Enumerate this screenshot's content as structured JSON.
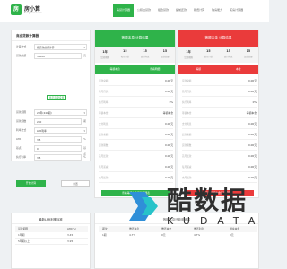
{
  "header": {
    "logo_glyph": "房",
    "brand_title": "房小算",
    "brand_sub": "fangxiaosuan",
    "nav": [
      "房贷计算器",
      "公积金贷款",
      "组合贷款",
      "提前还款",
      "税费计算",
      "购房能力",
      "买房计算器"
    ]
  },
  "form": {
    "title": "商业贷款计算器",
    "rows": [
      {
        "label": "计算方式",
        "value": "按贷款总额计算",
        "unit": ""
      },
      {
        "label": "贷款总额",
        "value": "50000",
        "unit": "元"
      },
      {
        "label": "贷款期限",
        "value": "20年(240期)",
        "unit": ""
      },
      {
        "label": "贷款期数",
        "value": "240",
        "unit": "期"
      },
      {
        "label": "利率方式",
        "value": "LPR利率",
        "unit": ""
      },
      {
        "label": "LPR",
        "value": "3.5",
        "unit": "%"
      },
      {
        "label": "基点",
        "value": "0",
        "unit": "基点"
      },
      {
        "label": "执行利率",
        "value": "3.5",
        "unit": "%"
      }
    ],
    "advanced_label": "显示高级设置",
    "calc_label": "开始计算",
    "reset_label": "重置"
  },
  "panels": [
    {
      "title": "等额本息 计算结果",
      "stats": [
        {
          "value": "1年",
          "key": "贷款期限"
        },
        {
          "value": "15",
          "key": "每月月供"
        },
        {
          "value": "15",
          "key": "支付利息"
        },
        {
          "value": "15",
          "key": "还款总额"
        }
      ],
      "buttons": [
        "等额本息",
        "查看明细"
      ],
      "rows": [
        {
          "key": "贷款总额",
          "value": "0.00元"
        },
        {
          "key": "每月月供",
          "value": "0.00元"
        },
        {
          "key": "执行利率",
          "value": "0%"
        },
        {
          "key": "等额本金",
          "value": "等额本金"
        },
        {
          "key": "支付利息",
          "value": "0.00元"
        },
        {
          "key": "还款总额",
          "value": "0.00元"
        },
        {
          "key": "贷款期数",
          "value": "0.00元"
        },
        {
          "key": "首月还款",
          "value": "0.00元"
        },
        {
          "key": "每月递减",
          "value": "0.00元"
        },
        {
          "key": "末月还款",
          "value": "0.00元"
        }
      ],
      "footer": "查看等额本息还款明细表"
    },
    {
      "title": "等额本金 计算结果",
      "stats": [
        {
          "value": "1年",
          "key": "贷款期限"
        },
        {
          "value": "15",
          "key": "首月月供"
        },
        {
          "value": "15",
          "key": "支付利息"
        },
        {
          "value": "15",
          "key": "还款总额"
        }
      ],
      "buttons": [
        "等额",
        "本金"
      ],
      "rows": [
        {
          "key": "贷款总额",
          "value": "0.00元"
        },
        {
          "key": "首月月供",
          "value": "0.00元"
        },
        {
          "key": "执行利率",
          "value": "0%"
        },
        {
          "key": "等额本金",
          "value": "等额本金"
        },
        {
          "key": "支付利息",
          "value": "0.00元"
        },
        {
          "key": "还款总额",
          "value": "0.00元"
        },
        {
          "key": "贷款期数",
          "value": "0.00元"
        },
        {
          "key": "首月还款",
          "value": "0.00元"
        },
        {
          "key": "每月递减",
          "value": "0.00元"
        },
        {
          "key": "末月还款",
          "value": "0.00元"
        }
      ],
      "footer": "查看等额本金还款明细表"
    }
  ],
  "lpr": {
    "title": "最新LPR利率标准",
    "headers": [
      "贷款期限",
      "LPR(%)"
    ],
    "rows": [
      [
        "1年期",
        "3.45"
      ],
      [
        "5年期以上",
        "3.95"
      ]
    ]
  },
  "table": {
    "title": "等额本息还款明细表",
    "headers": [
      "期次",
      "偿还本息",
      "偿还本金",
      "偿还利息",
      "剩余本金"
    ],
    "row": [
      "1期",
      "4.7%",
      "0元",
      "4.7%",
      "0元"
    ]
  },
  "watermark": {
    "cn": "酷数据",
    "en": "KUDATA",
    "colors": {
      "blue": "#2f8fd8",
      "teal": "#27c3c9"
    }
  }
}
